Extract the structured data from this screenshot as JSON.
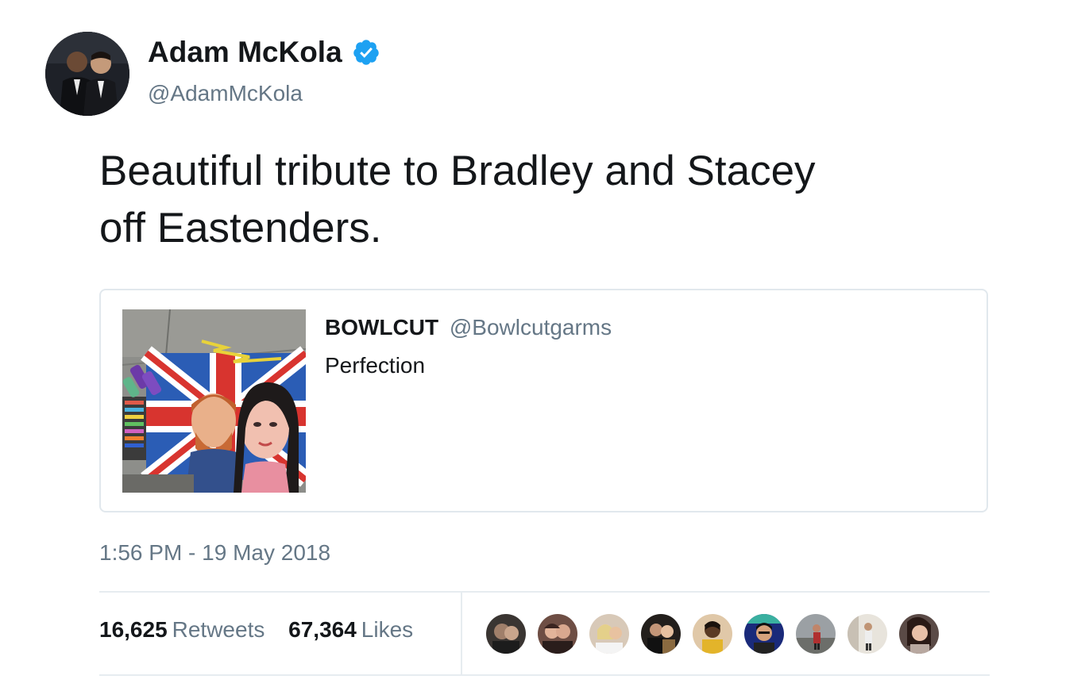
{
  "author": {
    "display_name": "Adam McKola",
    "handle": "@AdamMcKola",
    "verified": true
  },
  "tweet": {
    "text_line1": "Beautiful tribute to Bradley and Stacey",
    "text_line2": "off Eastenders.",
    "timestamp": "1:56 PM - 19 May 2018"
  },
  "quoted_tweet": {
    "author_name": "BOWLCUT",
    "author_handle": "@Bowlcutgarms",
    "text": "Perfection"
  },
  "stats": {
    "retweets_count": "16,625",
    "retweets_label": "Retweets",
    "likes_count": "67,364",
    "likes_label": "Likes"
  },
  "colors": {
    "text_primary": "#14171a",
    "text_secondary": "#657786",
    "verified_blue": "#1da1f2",
    "border": "#e1e8ed"
  }
}
